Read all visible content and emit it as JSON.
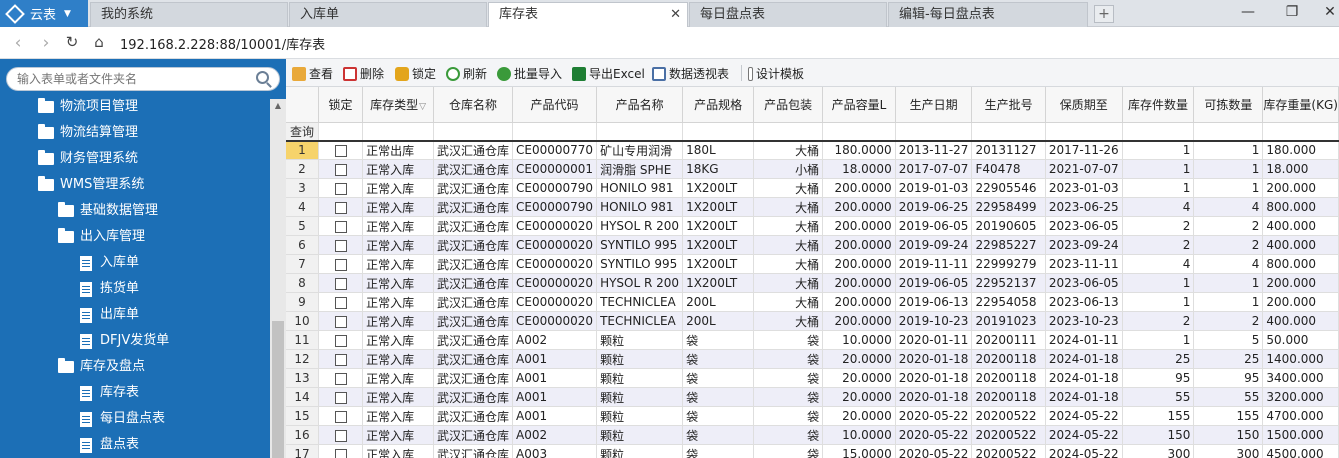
{
  "browser": {
    "app_name": "云表",
    "tabs": [
      {
        "label": "我的系统"
      },
      {
        "label": "入库单"
      },
      {
        "label": "库存表"
      },
      {
        "label": "每日盘点表"
      },
      {
        "label": "编辑-每日盘点表"
      }
    ],
    "address": "192.168.2.228:88/10001/库存表"
  },
  "sidebar": {
    "search_placeholder": "输入表单或者文件夹名",
    "items": [
      {
        "label": "物流项目管理",
        "type": "folder",
        "level": 1
      },
      {
        "label": "物流结算管理",
        "type": "folder",
        "level": 1
      },
      {
        "label": "财务管理系统",
        "type": "folder",
        "level": 1
      },
      {
        "label": "WMS管理系统",
        "type": "folder",
        "level": 1
      },
      {
        "label": "基础数据管理",
        "type": "folder",
        "level": 2
      },
      {
        "label": "出入库管理",
        "type": "folder",
        "level": 2
      },
      {
        "label": "入库单",
        "type": "doc",
        "level": 3
      },
      {
        "label": "拣货单",
        "type": "doc",
        "level": 3
      },
      {
        "label": "出库单",
        "type": "doc",
        "level": 3
      },
      {
        "label": "DFJV发货单",
        "type": "doc",
        "level": 3
      },
      {
        "label": "库存及盘点",
        "type": "folder",
        "level": 2
      },
      {
        "label": "库存表",
        "type": "doc",
        "level": 3
      },
      {
        "label": "每日盘点表",
        "type": "doc",
        "level": 3
      },
      {
        "label": "盘点表",
        "type": "doc",
        "level": 3
      }
    ]
  },
  "toolbar": {
    "view": "查看",
    "delete": "删除",
    "lock": "锁定",
    "refresh": "刷新",
    "batch_import": "批量导入",
    "export_excel": "导出Excel",
    "pivot": "数据透视表",
    "design_template": "设计模板"
  },
  "grid": {
    "columns": [
      "锁定",
      "库存类型",
      "仓库名称",
      "产品代码",
      "产品名称",
      "产品规格",
      "产品包装",
      "产品容量L",
      "生产日期",
      "生产批号",
      "保质期至",
      "库存件数量",
      "可拣数量",
      "库存重量(KG)"
    ],
    "query_label": "查询",
    "rows": [
      [
        "1",
        "正常出库",
        "武汉汇通仓库",
        "CE00000770",
        "矿山专用润滑",
        "180L",
        "大桶",
        "180.0000",
        "2013-11-27",
        "20131127",
        "2017-11-26",
        "1",
        "1",
        "180.000"
      ],
      [
        "2",
        "正常入库",
        "武汉汇通仓库",
        "CE00000001",
        "润滑脂 SPHE",
        "18KG",
        "小桶",
        "18.0000",
        "2017-07-07",
        "F40478",
        "2021-07-07",
        "1",
        "1",
        "18.000"
      ],
      [
        "3",
        "正常入库",
        "武汉汇通仓库",
        "CE00000790",
        "HONILO 981",
        "1X200LT",
        "大桶",
        "200.0000",
        "2019-01-03",
        "22905546",
        "2023-01-03",
        "1",
        "1",
        "200.000"
      ],
      [
        "4",
        "正常入库",
        "武汉汇通仓库",
        "CE00000790",
        "HONILO 981",
        "1X200LT",
        "大桶",
        "200.0000",
        "2019-06-25",
        "22958499",
        "2023-06-25",
        "4",
        "4",
        "800.000"
      ],
      [
        "5",
        "正常入库",
        "武汉汇通仓库",
        "CE00000020",
        "HYSOL R 200",
        "1X200LT",
        "大桶",
        "200.0000",
        "2019-06-05",
        "20190605",
        "2023-06-05",
        "2",
        "2",
        "400.000"
      ],
      [
        "6",
        "正常入库",
        "武汉汇通仓库",
        "CE00000020",
        "SYNTILO 995",
        "1X200LT",
        "大桶",
        "200.0000",
        "2019-09-24",
        "22985227",
        "2023-09-24",
        "2",
        "2",
        "400.000"
      ],
      [
        "7",
        "正常入库",
        "武汉汇通仓库",
        "CE00000020",
        "SYNTILO 995",
        "1X200LT",
        "大桶",
        "200.0000",
        "2019-11-11",
        "22999279",
        "2023-11-11",
        "4",
        "4",
        "800.000"
      ],
      [
        "8",
        "正常入库",
        "武汉汇通仓库",
        "CE00000020",
        "HYSOL R 200",
        "1X200LT",
        "大桶",
        "200.0000",
        "2019-06-05",
        "22952137",
        "2023-06-05",
        "1",
        "1",
        "200.000"
      ],
      [
        "9",
        "正常入库",
        "武汉汇通仓库",
        "CE00000020",
        "TECHNICLEA",
        "200L",
        "大桶",
        "200.0000",
        "2019-06-13",
        "22954058",
        "2023-06-13",
        "1",
        "1",
        "200.000"
      ],
      [
        "10",
        "正常入库",
        "武汉汇通仓库",
        "CE00000020",
        "TECHNICLEA",
        "200L",
        "大桶",
        "200.0000",
        "2019-10-23",
        "20191023",
        "2023-10-23",
        "2",
        "2",
        "400.000"
      ],
      [
        "11",
        "正常入库",
        "武汉汇通仓库",
        "A002",
        "颗粒",
        "袋",
        "袋",
        "10.0000",
        "2020-01-11",
        "20200111",
        "2024-01-11",
        "1",
        "5",
        "50.000"
      ],
      [
        "12",
        "正常入库",
        "武汉汇通仓库",
        "A001",
        "颗粒",
        "袋",
        "袋",
        "20.0000",
        "2020-01-18",
        "20200118",
        "2024-01-18",
        "25",
        "25",
        "1400.000"
      ],
      [
        "13",
        "正常入库",
        "武汉汇通仓库",
        "A001",
        "颗粒",
        "袋",
        "袋",
        "20.0000",
        "2020-01-18",
        "20200118",
        "2024-01-18",
        "95",
        "95",
        "3400.000"
      ],
      [
        "14",
        "正常入库",
        "武汉汇通仓库",
        "A001",
        "颗粒",
        "袋",
        "袋",
        "20.0000",
        "2020-01-18",
        "20200118",
        "2024-01-18",
        "55",
        "55",
        "3200.000"
      ],
      [
        "15",
        "正常入库",
        "武汉汇通仓库",
        "A001",
        "颗粒",
        "袋",
        "袋",
        "20.0000",
        "2020-05-22",
        "20200522",
        "2024-05-22",
        "155",
        "155",
        "4700.000"
      ],
      [
        "16",
        "正常入库",
        "武汉汇通仓库",
        "A002",
        "颗粒",
        "袋",
        "袋",
        "10.0000",
        "2020-05-22",
        "20200522",
        "2024-05-22",
        "150",
        "150",
        "1500.000"
      ],
      [
        "17",
        "正常入库",
        "武汉汇通仓库",
        "A003",
        "颗粒",
        "袋",
        "袋",
        "15.0000",
        "2020-05-22",
        "20200522",
        "2024-05-22",
        "300",
        "300",
        "4500.000"
      ]
    ]
  }
}
